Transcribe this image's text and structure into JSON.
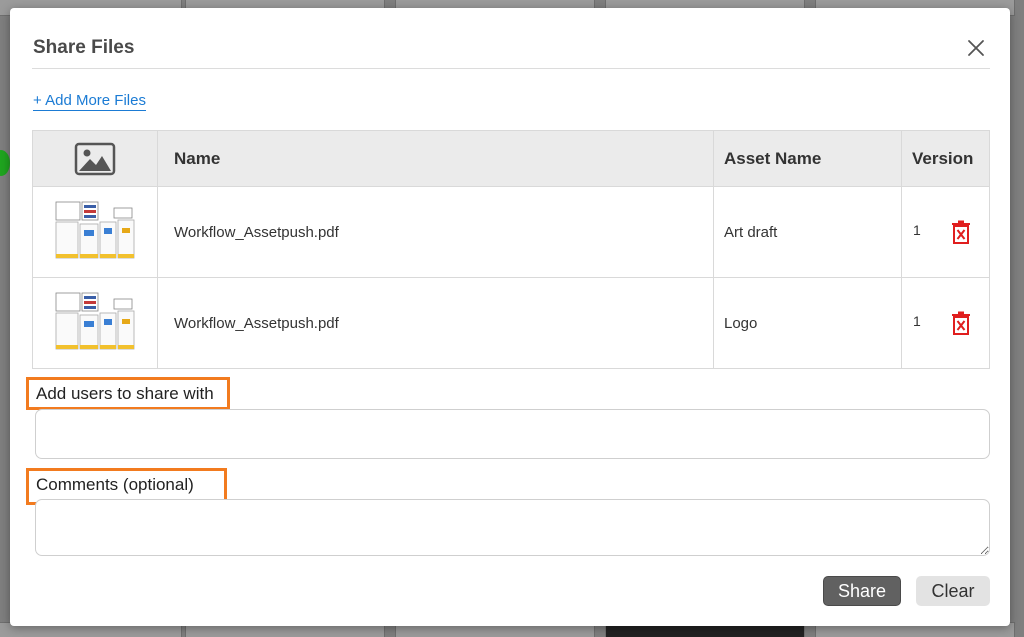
{
  "modal": {
    "title": "Share Files",
    "add_more_files": "+ Add More Files"
  },
  "table": {
    "headers": {
      "thumbnail_icon": "image-icon",
      "name": "Name",
      "asset_name": "Asset Name",
      "version": "Version"
    },
    "rows": [
      {
        "name": "Workflow_Assetpush.pdf",
        "asset_name": "Art draft",
        "version": "1"
      },
      {
        "name": "Workflow_Assetpush.pdf",
        "asset_name": "Logo",
        "version": "1"
      }
    ]
  },
  "form": {
    "users_label": "Add users to share with",
    "users_value": "",
    "comments_label": "Comments (optional)",
    "comments_value": ""
  },
  "buttons": {
    "share": "Share",
    "clear": "Clear"
  },
  "colors": {
    "link": "#1b7bd4",
    "highlight_border": "#f27b1f",
    "delete_icon": "#e01e1e",
    "share_button": "#616161",
    "clear_button": "#e3e3e3"
  }
}
